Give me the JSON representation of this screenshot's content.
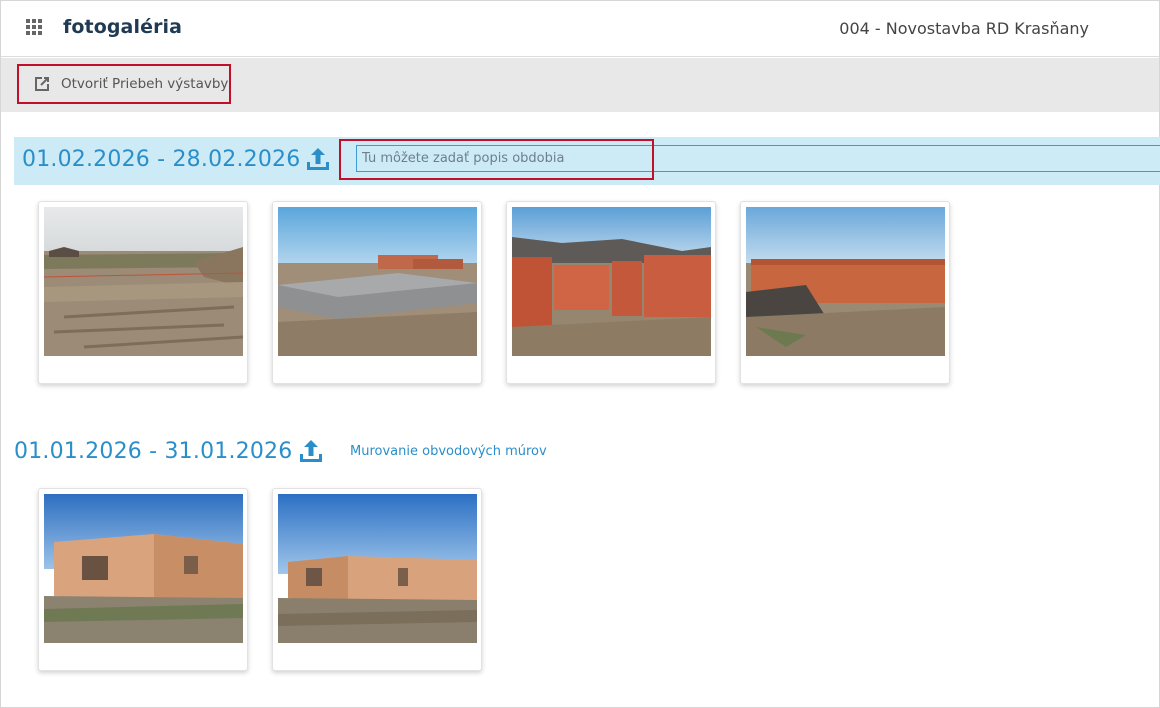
{
  "header": {
    "app_title": "fotogaléria",
    "project_name": "004 - Novostavba RD Krasňany"
  },
  "toolbar": {
    "open_button_label": "Otvoriť Priebeh výstavby",
    "open_button_icon": "open-in-new-icon"
  },
  "periods": [
    {
      "date_range": "01.02.2026 - 28.02.2026",
      "description_placeholder": "Tu môžete zadať popis obdobia",
      "description": "",
      "photo_count": 4
    },
    {
      "date_range": "01.01.2026 - 31.01.2026",
      "description": "Murovanie obvodových múrov",
      "photo_count": 2
    }
  ],
  "colors": {
    "accent": "#2a8fc9",
    "period_band": "#cdeaf7",
    "highlight": "#c0102a",
    "title": "#1f3a52"
  }
}
